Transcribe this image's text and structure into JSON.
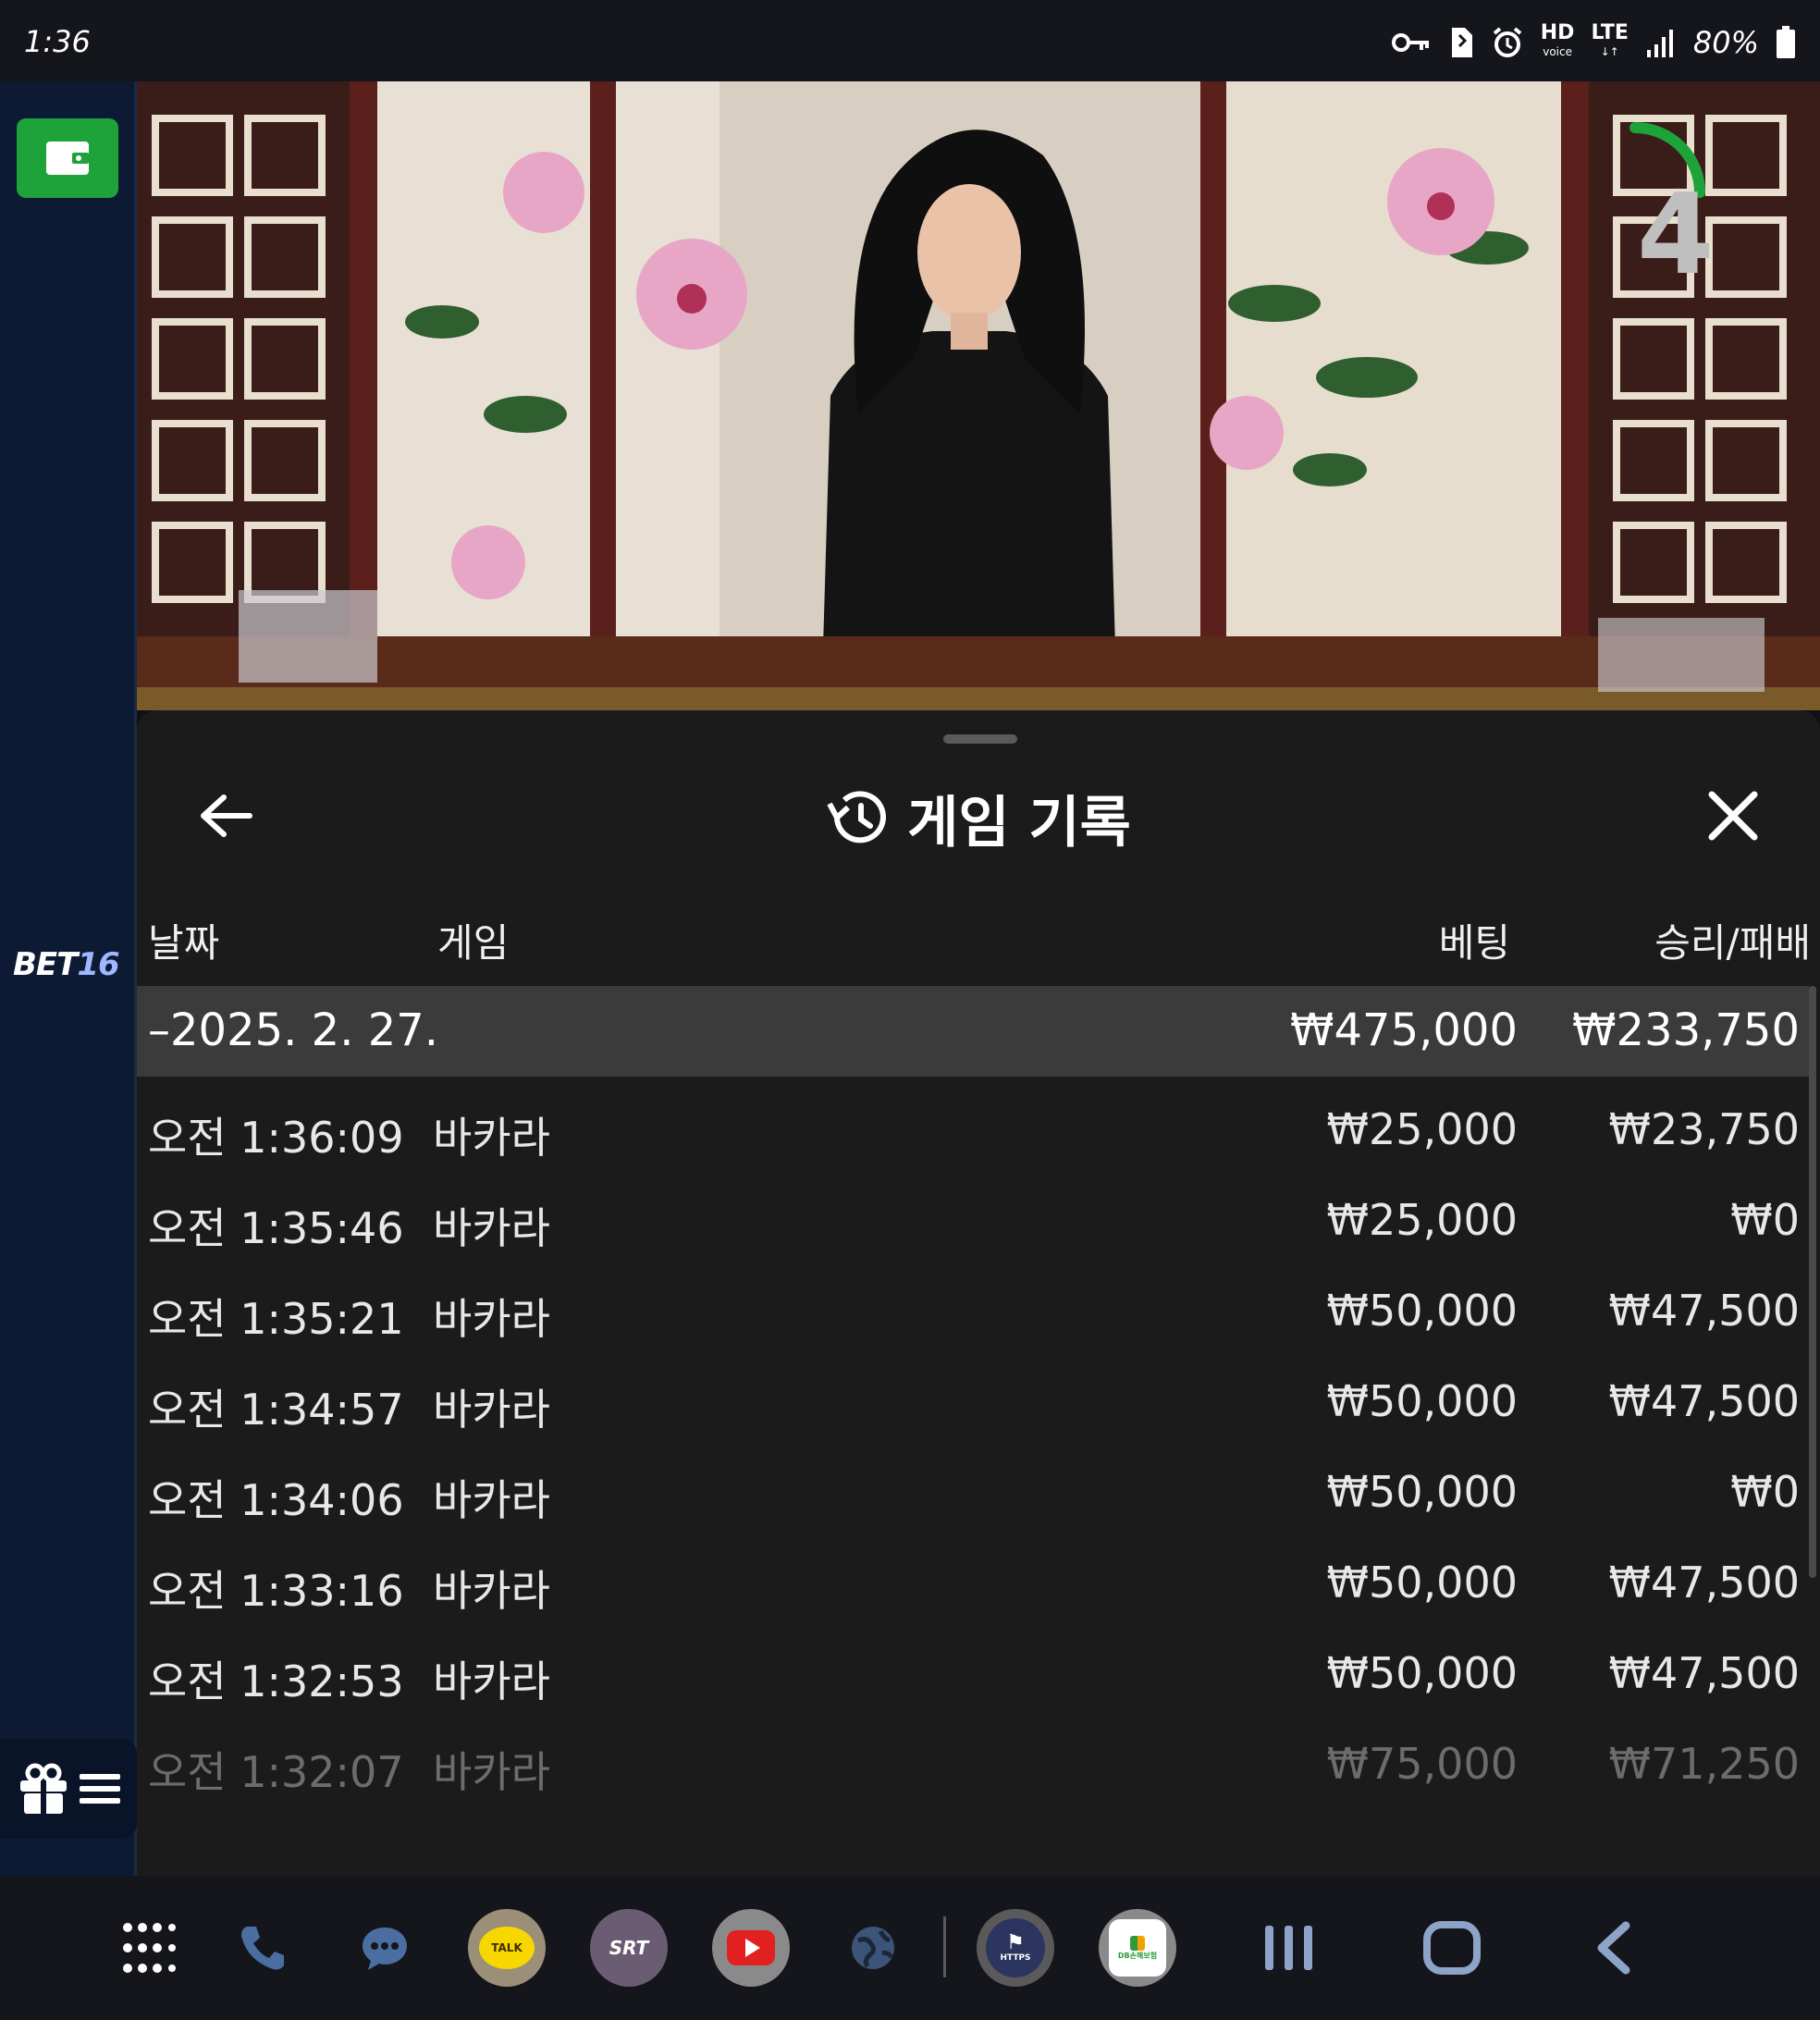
{
  "status_bar": {
    "time": "1:36",
    "hd_label": "HD",
    "hd_sub": "voice",
    "lte_label": "LTE",
    "battery_percent": "80%"
  },
  "sidebar": {
    "brand_prefix": "BET",
    "brand_suffix": "16"
  },
  "video": {
    "countdown": "4",
    "countdown_progress": 0.3
  },
  "sheet": {
    "title": "게임 기록",
    "columns": {
      "date": "날짜",
      "game": "게임",
      "bet": "베팅",
      "win_loss": "승리/패배"
    },
    "summary": {
      "date": "–2025. 2. 27.",
      "bet": "₩475,000",
      "win": "₩233,750"
    },
    "rows": [
      {
        "time": "오전 1:36:09",
        "game": "바카라",
        "bet": "₩25,000",
        "win": "₩23,750"
      },
      {
        "time": "오전 1:35:46",
        "game": "바카라",
        "bet": "₩25,000",
        "win": "₩0"
      },
      {
        "time": "오전 1:35:21",
        "game": "바카라",
        "bet": "₩50,000",
        "win": "₩47,500"
      },
      {
        "time": "오전 1:34:57",
        "game": "바카라",
        "bet": "₩50,000",
        "win": "₩47,500"
      },
      {
        "time": "오전 1:34:06",
        "game": "바카라",
        "bet": "₩50,000",
        "win": "₩0"
      },
      {
        "time": "오전 1:33:16",
        "game": "바카라",
        "bet": "₩50,000",
        "win": "₩47,500"
      },
      {
        "time": "오전 1:32:53",
        "game": "바카라",
        "bet": "₩50,000",
        "win": "₩47,500"
      },
      {
        "time": "오전 1:32:07",
        "game": "바카라",
        "bet": "₩75,000",
        "win": "₩71,250"
      }
    ]
  },
  "navbar": {
    "apps": [
      "app-drawer-icon",
      "phone-icon",
      "messages-icon",
      "kakaotalk-icon",
      "srt-icon",
      "youtube-icon",
      "browser-icon",
      "https-app-icon",
      "db-insurance-icon"
    ],
    "kakao_label": "TALK",
    "srt_label": "SRT",
    "https_label": "HTTPS",
    "db_label": "DB손해보험"
  },
  "colors": {
    "accent_green": "#1ea33a",
    "sheet_bg": "#1b1b1b",
    "summary_bg": "#3b3b3b",
    "sidebar_bg": "#0c1a33"
  }
}
